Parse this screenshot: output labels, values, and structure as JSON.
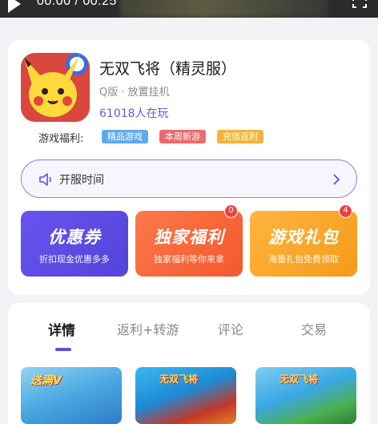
{
  "video": {
    "time": "00:00 / 00:25"
  },
  "game": {
    "title": "无双飞将（精灵服）",
    "meta": "Q版 · 放置挂机",
    "players": "61018人在玩",
    "icon": "game-icon-pikachu"
  },
  "welfare": {
    "label": "游戏福利:",
    "tags": [
      "精品游戏",
      "本周新游",
      "充值返利"
    ],
    "tag_colors": [
      "#5fa9ee",
      "#ec6b6b",
      "#f4b43c"
    ]
  },
  "server": {
    "label": "开服时间",
    "icon": "speaker-icon"
  },
  "promos": [
    {
      "title": "优惠券",
      "subtitle": "折扣现金优惠多多",
      "badge": ""
    },
    {
      "title": "独家福利",
      "subtitle": "独家福利等你来拿",
      "badge": "0"
    },
    {
      "title": "游戏礼包",
      "subtitle": "海量礼包免费领取",
      "badge": "4"
    }
  ],
  "tabs": [
    {
      "label": "详情",
      "active": true
    },
    {
      "label": "返利+转游",
      "active": false
    },
    {
      "label": "评论",
      "active": false
    },
    {
      "label": "交易",
      "active": false
    }
  ],
  "screenshots": {
    "first_caption": "送满V"
  },
  "colors": {
    "accent": "#5b4de0",
    "players_text": "#5f5fd6"
  }
}
